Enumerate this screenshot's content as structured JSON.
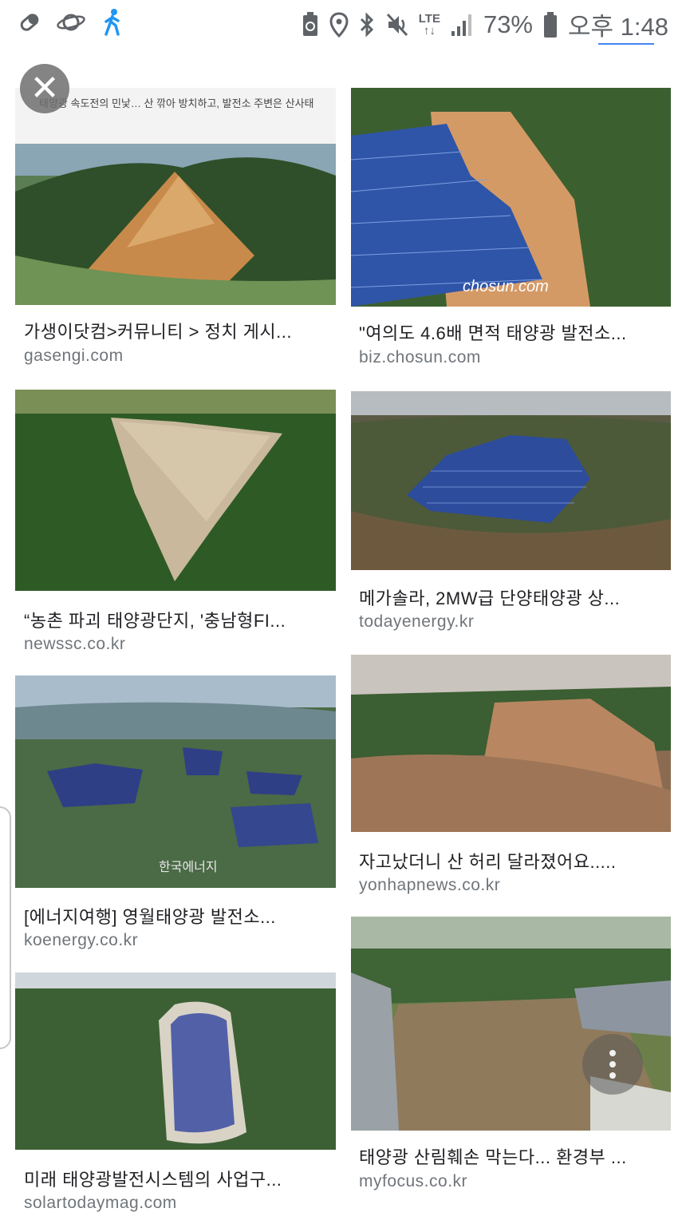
{
  "status_bar": {
    "battery_percent": "73%",
    "time": "오후 1:48",
    "network": "LTE",
    "icons_left": [
      "pill-icon",
      "planet-icon",
      "walking-icon"
    ],
    "icons_right": [
      "recycle-icon",
      "location-pin-icon",
      "bluetooth-icon",
      "mute-icon",
      "lte-icon",
      "signal-icon",
      "battery-icon"
    ]
  },
  "results": [
    {
      "caption": "가생이닷컴>커뮤니티 > 정치 게시...",
      "source": "gasengi.com",
      "image_text": "태양광 속도전의 민낯… 산 깎아 방치하고, 발전소 주변은 산사태"
    },
    {
      "caption": "\"여의도 4.6배 면적 태양광 발전소...",
      "source": "biz.chosun.com",
      "image_text": "chosun.com"
    },
    {
      "caption": "“농촌 파괴 태양광단지, '충남형FI...",
      "source": "newssc.co.kr"
    },
    {
      "caption": "메가솔라, 2MW급 단양태양광 상...",
      "source": "todayenergy.kr"
    },
    {
      "caption": "[에너지여행] 영월태양광 발전소...",
      "source": "koenergy.co.kr",
      "image_text": "한국에너지"
    },
    {
      "caption": "자고났더니 산 허리 달라졌어요.....",
      "source": "yonhapnews.co.kr"
    },
    {
      "caption": "미래 태양광발전시스템의 사업구...",
      "source": "solartodaymag.com"
    },
    {
      "caption": "태양광 산림훼손 막는다... 환경부 ...",
      "source": "myfocus.co.kr"
    }
  ],
  "controls": {
    "close_icon": "close-icon",
    "more_icon": "more-vertical-icon"
  },
  "colors": {
    "caption": "#202124",
    "source": "#70757a",
    "status": "#5f6368"
  }
}
